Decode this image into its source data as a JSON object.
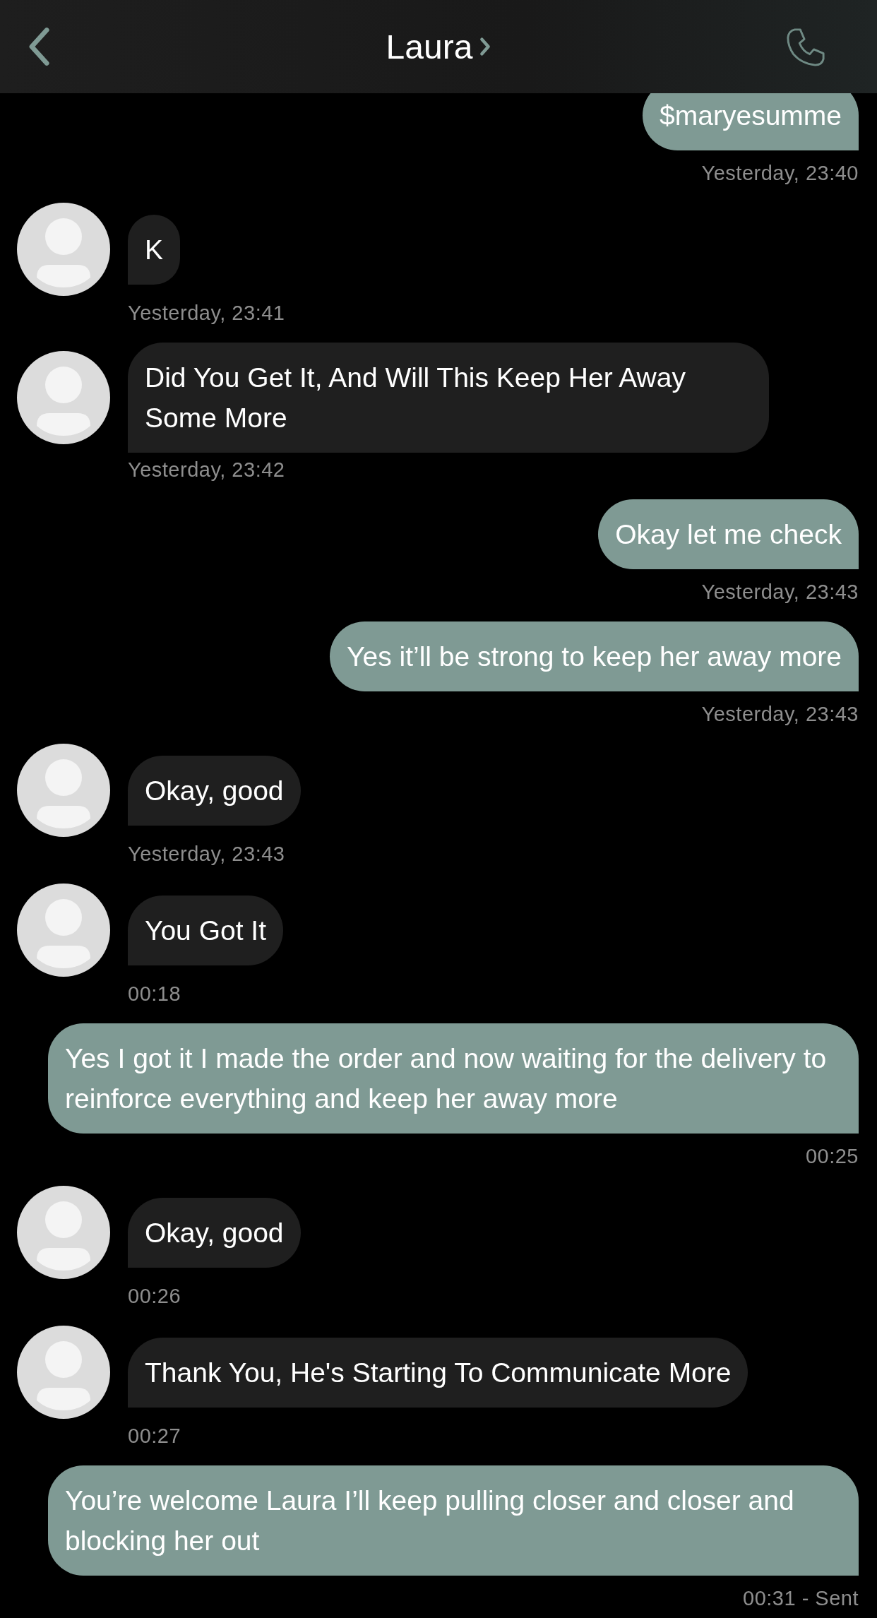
{
  "header": {
    "title": "Laura"
  },
  "messages": [
    {
      "kind": "outgoing",
      "text": "$maryesumme",
      "time": "Yesterday, 23:40"
    },
    {
      "kind": "incoming",
      "text": "K",
      "time": "Yesterday, 23:41"
    },
    {
      "kind": "incoming",
      "text": "Did You Get It, And Will This Keep Her Away Some More",
      "time": "Yesterday, 23:42"
    },
    {
      "kind": "outgoing",
      "text": "Okay let me check",
      "time": "Yesterday, 23:43"
    },
    {
      "kind": "outgoing",
      "text": "Yes it’ll be strong to keep her away more",
      "time": "Yesterday, 23:43"
    },
    {
      "kind": "incoming",
      "text": "Okay, good",
      "time": "Yesterday, 23:43"
    },
    {
      "kind": "incoming",
      "text": "You Got It",
      "time": "00:18"
    },
    {
      "kind": "outgoing",
      "text": "Yes I got it I made the order and now waiting for the delivery to reinforce everything and keep her away more",
      "time": "00:25"
    },
    {
      "kind": "incoming",
      "text": "Okay, good",
      "time": "00:26"
    },
    {
      "kind": "incoming",
      "text": "Thank You, He's Starting To Communicate More",
      "time": "00:27"
    },
    {
      "kind": "outgoing",
      "text": "You’re welcome Laura I’ll keep pulling closer and closer and blocking her out",
      "time": "00:31 - Sent"
    }
  ]
}
